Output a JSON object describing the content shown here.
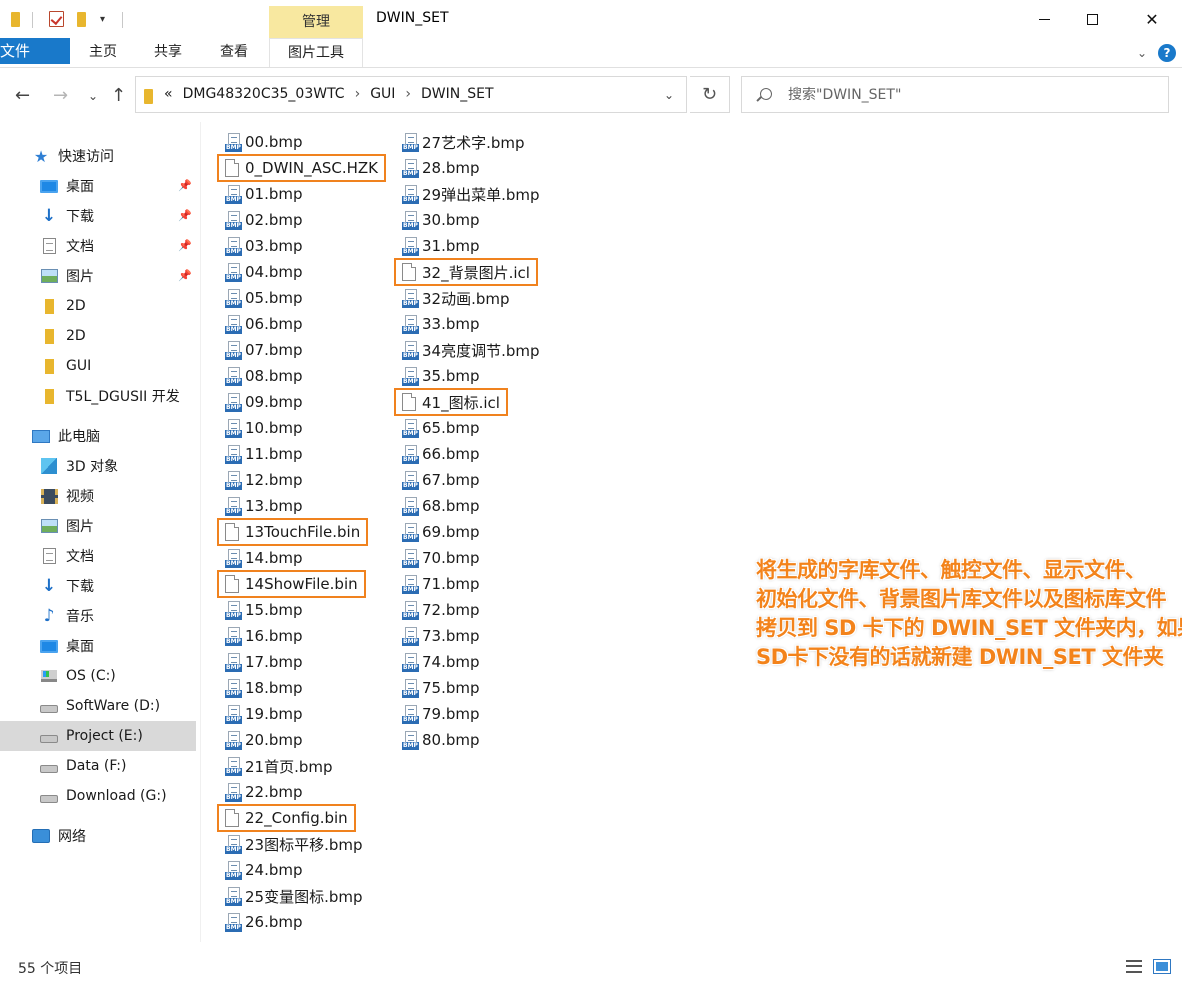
{
  "window": {
    "title": "DWIN_SET",
    "contextual_group_label": "管理",
    "minimize_label": "",
    "close_glyph": "✕"
  },
  "ribbon": {
    "tabs": [
      {
        "label": "文件",
        "active": false
      },
      {
        "label": "主页",
        "active": false
      },
      {
        "label": "共享",
        "active": false
      },
      {
        "label": "查看",
        "active": false
      },
      {
        "label": "图片工具",
        "active": true
      }
    ],
    "help_glyph": "?"
  },
  "address_bar": {
    "overflow_glyph": "«",
    "crumbs": [
      "DMG48320C35_03WTC",
      "GUI",
      "DWIN_SET"
    ],
    "separator": "›"
  },
  "search": {
    "placeholder": "搜索\"DWIN_SET\""
  },
  "sidebar": {
    "items": [
      {
        "label": "快速访问",
        "icon": "star-icon",
        "pinned": false
      },
      {
        "label": "桌面",
        "icon": "desktop-icon",
        "pinned": true
      },
      {
        "label": "下载",
        "icon": "download-icon",
        "pinned": true
      },
      {
        "label": "文档",
        "icon": "document-icon",
        "pinned": true
      },
      {
        "label": "图片",
        "icon": "pictures-icon",
        "pinned": true
      },
      {
        "label": "2D",
        "icon": "folder-icon",
        "pinned": false
      },
      {
        "label": "2D",
        "icon": "folder-icon",
        "pinned": false
      },
      {
        "label": "GUI",
        "icon": "folder-icon",
        "pinned": false
      },
      {
        "label": "T5L_DGUSII 开发",
        "icon": "folder-icon",
        "pinned": false
      },
      {
        "label": "此电脑",
        "icon": "computer-icon",
        "pinned": false
      },
      {
        "label": "3D 对象",
        "icon": "3d-objects-icon",
        "pinned": false
      },
      {
        "label": "视频",
        "icon": "video-icon",
        "pinned": false
      },
      {
        "label": "图片",
        "icon": "pictures-icon",
        "pinned": false
      },
      {
        "label": "文档",
        "icon": "document-icon",
        "pinned": false
      },
      {
        "label": "下载",
        "icon": "download-icon",
        "pinned": false
      },
      {
        "label": "音乐",
        "icon": "music-icon",
        "pinned": false
      },
      {
        "label": "桌面",
        "icon": "desktop-icon",
        "pinned": false
      },
      {
        "label": "OS (C:)",
        "icon": "os-drive-icon",
        "pinned": false
      },
      {
        "label": "SoftWare (D:)",
        "icon": "drive-icon",
        "pinned": false
      },
      {
        "label": "Project (E:)",
        "icon": "drive-icon",
        "pinned": false,
        "selected": true
      },
      {
        "label": "Data (F:)",
        "icon": "drive-icon",
        "pinned": false
      },
      {
        "label": "Download (G:)",
        "icon": "drive-icon",
        "pinned": false
      },
      {
        "label": "网络",
        "icon": "network-icon",
        "pinned": false
      }
    ]
  },
  "files": {
    "column1": [
      {
        "name": "00.bmp",
        "type": "bmp"
      },
      {
        "name": "0_DWIN_ASC.HZK",
        "type": "generic",
        "highlight": true
      },
      {
        "name": "01.bmp",
        "type": "bmp"
      },
      {
        "name": "02.bmp",
        "type": "bmp"
      },
      {
        "name": "03.bmp",
        "type": "bmp"
      },
      {
        "name": "04.bmp",
        "type": "bmp"
      },
      {
        "name": "05.bmp",
        "type": "bmp"
      },
      {
        "name": "06.bmp",
        "type": "bmp"
      },
      {
        "name": "07.bmp",
        "type": "bmp"
      },
      {
        "name": "08.bmp",
        "type": "bmp"
      },
      {
        "name": "09.bmp",
        "type": "bmp"
      },
      {
        "name": "10.bmp",
        "type": "bmp"
      },
      {
        "name": "11.bmp",
        "type": "bmp"
      },
      {
        "name": "12.bmp",
        "type": "bmp"
      },
      {
        "name": "13.bmp",
        "type": "bmp"
      },
      {
        "name": "13TouchFile.bin",
        "type": "generic",
        "highlight": true
      },
      {
        "name": "14.bmp",
        "type": "bmp"
      },
      {
        "name": "14ShowFile.bin",
        "type": "generic",
        "highlight": true
      },
      {
        "name": "15.bmp",
        "type": "bmp"
      },
      {
        "name": "16.bmp",
        "type": "bmp"
      },
      {
        "name": "17.bmp",
        "type": "bmp"
      },
      {
        "name": "18.bmp",
        "type": "bmp"
      },
      {
        "name": "19.bmp",
        "type": "bmp"
      },
      {
        "name": "20.bmp",
        "type": "bmp"
      },
      {
        "name": "21首页.bmp",
        "type": "bmp"
      },
      {
        "name": "22.bmp",
        "type": "bmp"
      },
      {
        "name": "22_Config.bin",
        "type": "generic",
        "highlight": true
      },
      {
        "name": "23图标平移.bmp",
        "type": "bmp"
      },
      {
        "name": "24.bmp",
        "type": "bmp"
      },
      {
        "name": "25变量图标.bmp",
        "type": "bmp"
      },
      {
        "name": "26.bmp",
        "type": "bmp"
      }
    ],
    "column2": [
      {
        "name": "27艺术字.bmp",
        "type": "bmp"
      },
      {
        "name": "28.bmp",
        "type": "bmp"
      },
      {
        "name": "29弹出菜单.bmp",
        "type": "bmp"
      },
      {
        "name": "30.bmp",
        "type": "bmp"
      },
      {
        "name": "31.bmp",
        "type": "bmp"
      },
      {
        "name": "32_背景图片.icl",
        "type": "generic",
        "highlight": true
      },
      {
        "name": "32动画.bmp",
        "type": "bmp"
      },
      {
        "name": "33.bmp",
        "type": "bmp"
      },
      {
        "name": "34亮度调节.bmp",
        "type": "bmp"
      },
      {
        "name": "35.bmp",
        "type": "bmp"
      },
      {
        "name": "41_图标.icl",
        "type": "generic",
        "highlight": true
      },
      {
        "name": "65.bmp",
        "type": "bmp"
      },
      {
        "name": "66.bmp",
        "type": "bmp"
      },
      {
        "name": "67.bmp",
        "type": "bmp"
      },
      {
        "name": "68.bmp",
        "type": "bmp"
      },
      {
        "name": "69.bmp",
        "type": "bmp"
      },
      {
        "name": "70.bmp",
        "type": "bmp"
      },
      {
        "name": "71.bmp",
        "type": "bmp"
      },
      {
        "name": "72.bmp",
        "type": "bmp"
      },
      {
        "name": "73.bmp",
        "type": "bmp"
      },
      {
        "name": "74.bmp",
        "type": "bmp"
      },
      {
        "name": "75.bmp",
        "type": "bmp"
      },
      {
        "name": "79.bmp",
        "type": "bmp"
      },
      {
        "name": "80.bmp",
        "type": "bmp"
      }
    ]
  },
  "annotation": {
    "lines": [
      "将生成的字库文件、触控文件、显示文件、",
      "初始化文件、背景图片库文件以及图标库文件",
      "拷贝到 SD 卡下的 DWIN_SET 文件夹内，如果",
      "SD卡下没有的话就新建 DWIN_SET 文件夹"
    ],
    "color": "#f3831b"
  },
  "status_bar": {
    "item_count": "55 个项目"
  },
  "colors": {
    "accent": "#1979ca",
    "highlight_box": "#f0821e",
    "manage_tab": "#f8e8a0",
    "selected_nav": "#d9d9d9"
  }
}
